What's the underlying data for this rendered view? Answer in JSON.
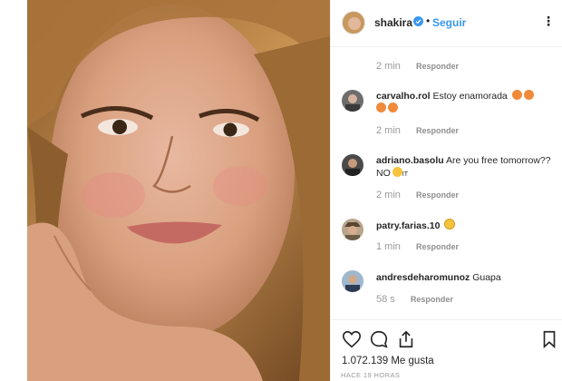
{
  "post": {
    "username": "shakira",
    "separator": "•",
    "follow_label": "Seguir",
    "more_label": "⋮",
    "likes": "1.072.139 Me gusta",
    "posted_ago": "HACE 19 HORAS"
  },
  "reply_label": "Responder",
  "top_time": "2 min",
  "comments": [
    {
      "user": "carvalho.rol",
      "text": "Estoy enamorada",
      "emoji_count": 4,
      "time": "2 min"
    },
    {
      "user": "adriano.basolu",
      "text": "Are you free tomorrow?? NO",
      "suffix": "IT",
      "time": "2 min"
    },
    {
      "user": "patry.farias.10",
      "text": "",
      "time": "1 min"
    },
    {
      "user": "andresdeharomunoz",
      "text": "Guapa",
      "time": "58 s"
    }
  ],
  "icons": {
    "like": "heart-outline-icon",
    "comment": "speech-bubble-icon",
    "share": "share-icon",
    "save": "bookmark-icon",
    "verified": "verified-badge-icon",
    "more": "more-options-icon"
  },
  "colors": {
    "follow_blue": "#3897f0",
    "verified_blue": "#3897f0",
    "muted": "#999999",
    "border": "#efefef"
  }
}
